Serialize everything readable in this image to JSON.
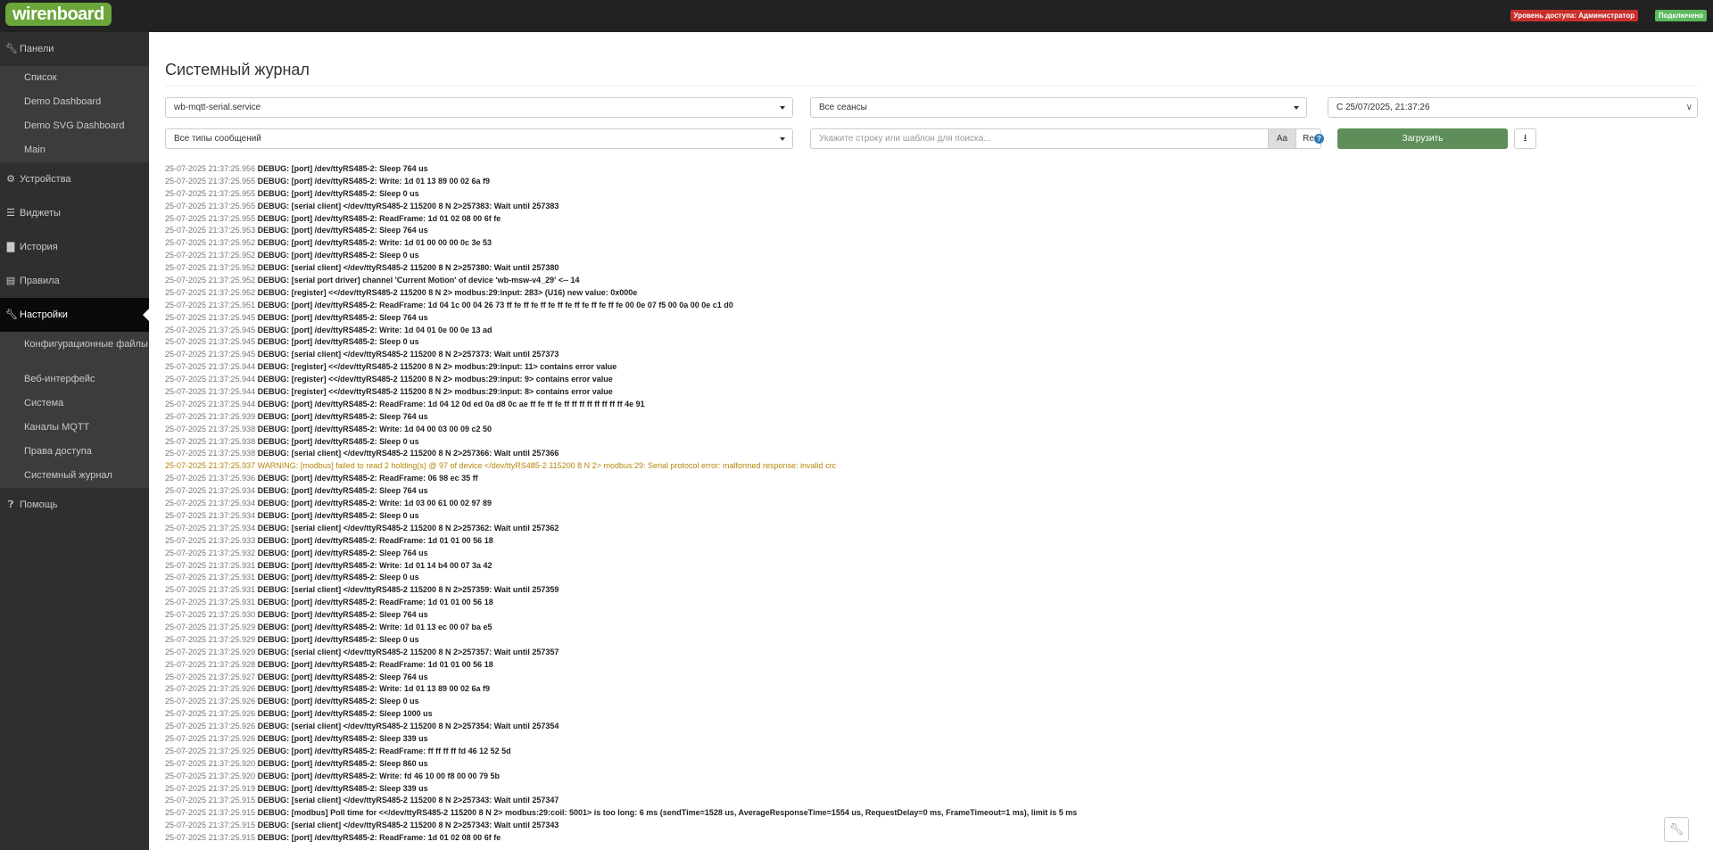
{
  "header": {
    "logo": "wirenboard",
    "access_badge": "Уровень доступа: Администратор",
    "connection_badge": "Подключено"
  },
  "sidebar": {
    "panels": {
      "label": "Панели",
      "icon": "wrench-icon",
      "items": [
        "Список",
        "Demo Dashboard",
        "Demo SVG Dashboard",
        "Main"
      ]
    },
    "devices": {
      "label": "Устройства",
      "icon": "gear-icon"
    },
    "widgets": {
      "label": "Виджеты",
      "icon": "list-icon"
    },
    "history": {
      "label": "История",
      "icon": "bar-chart-icon"
    },
    "rules": {
      "label": "Правила",
      "icon": "document-icon"
    },
    "settings": {
      "label": "Настройки",
      "icon": "wrench-icon",
      "items": [
        "Конфигурационные файлы",
        "Веб-интерфейс",
        "Система",
        "Каналы MQTT",
        "Права доступа",
        "Системный журнал"
      ]
    },
    "help": {
      "label": "Помощь",
      "icon": "question-icon"
    }
  },
  "page": {
    "title": "Системный журнал",
    "filters": {
      "service": "wb-mqtt-serial.service",
      "sessions": "Все сеансы",
      "since": "С 25/07/2025, 21:37:26",
      "message_types": "Все типы сообщений",
      "search_placeholder": "Укажите строку или шаблон для поиска...",
      "case_toggle": "Aa",
      "regex_toggle": "Re",
      "help": "?",
      "load_button": "Загрузить",
      "download_icon": "download-icon"
    }
  },
  "log": [
    {
      "ts": "25-07-2025 21:37:25.956",
      "msg": "DEBUG: [port] /dev/ttyRS485-2: Sleep 764 us"
    },
    {
      "ts": "25-07-2025 21:37:25.955",
      "msg": "DEBUG: [port] /dev/ttyRS485-2: Write: 1d 01 13 89 00 02 6a f9"
    },
    {
      "ts": "25-07-2025 21:37:25.955",
      "msg": "DEBUG: [port] /dev/ttyRS485-2: Sleep 0 us"
    },
    {
      "ts": "25-07-2025 21:37:25.955",
      "msg": "DEBUG: [serial client] </dev/ttyRS485-2 115200 8 N 2>257383: Wait until 257383"
    },
    {
      "ts": "25-07-2025 21:37:25.955",
      "msg": "DEBUG: [port] /dev/ttyRS485-2: ReadFrame: 1d 01 02 08 00 6f fe"
    },
    {
      "ts": "25-07-2025 21:37:25.953",
      "msg": "DEBUG: [port] /dev/ttyRS485-2: Sleep 764 us"
    },
    {
      "ts": "25-07-2025 21:37:25.952",
      "msg": "DEBUG: [port] /dev/ttyRS485-2: Write: 1d 01 00 00 00 0c 3e 53"
    },
    {
      "ts": "25-07-2025 21:37:25.952",
      "msg": "DEBUG: [port] /dev/ttyRS485-2: Sleep 0 us"
    },
    {
      "ts": "25-07-2025 21:37:25.952",
      "msg": "DEBUG: [serial client] </dev/ttyRS485-2 115200 8 N 2>257380: Wait until 257380"
    },
    {
      "ts": "25-07-2025 21:37:25.952",
      "msg": "DEBUG: [serial port driver] channel 'Current Motion' of device 'wb-msw-v4_29' <-- 14"
    },
    {
      "ts": "25-07-2025 21:37:25.952",
      "msg": "DEBUG: [register] <</dev/ttyRS485-2 115200 8 N 2> modbus:29:input: 283> (U16) new value: 0x000e"
    },
    {
      "ts": "25-07-2025 21:37:25.951",
      "msg": "DEBUG: [port] /dev/ttyRS485-2: ReadFrame: 1d 04 1c 00 04 26 73 ff fe ff fe ff fe ff fe ff fe ff fe ff fe 00 0e 07 f5 00 0a 00 0e c1 d0"
    },
    {
      "ts": "25-07-2025 21:37:25.945",
      "msg": "DEBUG: [port] /dev/ttyRS485-2: Sleep 764 us"
    },
    {
      "ts": "25-07-2025 21:37:25.945",
      "msg": "DEBUG: [port] /dev/ttyRS485-2: Write: 1d 04 01 0e 00 0e 13 ad"
    },
    {
      "ts": "25-07-2025 21:37:25.945",
      "msg": "DEBUG: [port] /dev/ttyRS485-2: Sleep 0 us"
    },
    {
      "ts": "25-07-2025 21:37:25.945",
      "msg": "DEBUG: [serial client] </dev/ttyRS485-2 115200 8 N 2>257373: Wait until 257373"
    },
    {
      "ts": "25-07-2025 21:37:25.944",
      "msg": "DEBUG: [register] <</dev/ttyRS485-2 115200 8 N 2> modbus:29:input: 11> contains error value"
    },
    {
      "ts": "25-07-2025 21:37:25.944",
      "msg": "DEBUG: [register] <</dev/ttyRS485-2 115200 8 N 2> modbus:29:input: 9> contains error value"
    },
    {
      "ts": "25-07-2025 21:37:25.944",
      "msg": "DEBUG: [register] <</dev/ttyRS485-2 115200 8 N 2> modbus:29:input: 8> contains error value"
    },
    {
      "ts": "25-07-2025 21:37:25.944",
      "msg": "DEBUG: [port] /dev/ttyRS485-2: ReadFrame: 1d 04 12 0d ed 0a d8 0c ae ff fe ff fe ff ff ff ff ff ff ff ff 4e 91"
    },
    {
      "ts": "25-07-2025 21:37:25.939",
      "msg": "DEBUG: [port] /dev/ttyRS485-2: Sleep 764 us"
    },
    {
      "ts": "25-07-2025 21:37:25.938",
      "msg": "DEBUG: [port] /dev/ttyRS485-2: Write: 1d 04 00 03 00 09 c2 50"
    },
    {
      "ts": "25-07-2025 21:37:25.938",
      "msg": "DEBUG: [port] /dev/ttyRS485-2: Sleep 0 us"
    },
    {
      "ts": "25-07-2025 21:37:25.938",
      "msg": "DEBUG: [serial client] </dev/ttyRS485-2 115200 8 N 2>257366: Wait until 257366"
    },
    {
      "ts": "25-07-2025 21:37:25.937",
      "msg": "WARNING: [modbus] failed to read 2 holding(s) @ 97 of device </dev/ttyRS485-2 115200 8 N 2> modbus:29: Serial protocol error: malformed response: invalid crc",
      "level": "warning"
    },
    {
      "ts": "25-07-2025 21:37:25.936",
      "msg": "DEBUG: [port] /dev/ttyRS485-2: ReadFrame: 06 98 ec 35 ff"
    },
    {
      "ts": "25-07-2025 21:37:25.934",
      "msg": "DEBUG: [port] /dev/ttyRS485-2: Sleep 764 us"
    },
    {
      "ts": "25-07-2025 21:37:25.934",
      "msg": "DEBUG: [port] /dev/ttyRS485-2: Write: 1d 03 00 61 00 02 97 89"
    },
    {
      "ts": "25-07-2025 21:37:25.934",
      "msg": "DEBUG: [port] /dev/ttyRS485-2: Sleep 0 us"
    },
    {
      "ts": "25-07-2025 21:37:25.934",
      "msg": "DEBUG: [serial client] </dev/ttyRS485-2 115200 8 N 2>257362: Wait until 257362"
    },
    {
      "ts": "25-07-2025 21:37:25.933",
      "msg": "DEBUG: [port] /dev/ttyRS485-2: ReadFrame: 1d 01 01 00 56 18"
    },
    {
      "ts": "25-07-2025 21:37:25.932",
      "msg": "DEBUG: [port] /dev/ttyRS485-2: Sleep 764 us"
    },
    {
      "ts": "25-07-2025 21:37:25.931",
      "msg": "DEBUG: [port] /dev/ttyRS485-2: Write: 1d 01 14 b4 00 07 3a 42"
    },
    {
      "ts": "25-07-2025 21:37:25.931",
      "msg": "DEBUG: [port] /dev/ttyRS485-2: Sleep 0 us"
    },
    {
      "ts": "25-07-2025 21:37:25.931",
      "msg": "DEBUG: [serial client] </dev/ttyRS485-2 115200 8 N 2>257359: Wait until 257359"
    },
    {
      "ts": "25-07-2025 21:37:25.931",
      "msg": "DEBUG: [port] /dev/ttyRS485-2: ReadFrame: 1d 01 01 00 56 18"
    },
    {
      "ts": "25-07-2025 21:37:25.930",
      "msg": "DEBUG: [port] /dev/ttyRS485-2: Sleep 764 us"
    },
    {
      "ts": "25-07-2025 21:37:25.929",
      "msg": "DEBUG: [port] /dev/ttyRS485-2: Write: 1d 01 13 ec 00 07 ba e5"
    },
    {
      "ts": "25-07-2025 21:37:25.929",
      "msg": "DEBUG: [port] /dev/ttyRS485-2: Sleep 0 us"
    },
    {
      "ts": "25-07-2025 21:37:25.929",
      "msg": "DEBUG: [serial client] </dev/ttyRS485-2 115200 8 N 2>257357: Wait until 257357"
    },
    {
      "ts": "25-07-2025 21:37:25.928",
      "msg": "DEBUG: [port] /dev/ttyRS485-2: ReadFrame: 1d 01 01 00 56 18"
    },
    {
      "ts": "25-07-2025 21:37:25.927",
      "msg": "DEBUG: [port] /dev/ttyRS485-2: Sleep 764 us"
    },
    {
      "ts": "25-07-2025 21:37:25.926",
      "msg": "DEBUG: [port] /dev/ttyRS485-2: Write: 1d 01 13 89 00 02 6a f9"
    },
    {
      "ts": "25-07-2025 21:37:25.926",
      "msg": "DEBUG: [port] /dev/ttyRS485-2: Sleep 0 us"
    },
    {
      "ts": "25-07-2025 21:37:25.926",
      "msg": "DEBUG: [port] /dev/ttyRS485-2: Sleep 1000 us"
    },
    {
      "ts": "25-07-2025 21:37:25.926",
      "msg": "DEBUG: [serial client] </dev/ttyRS485-2 115200 8 N 2>257354: Wait until 257354"
    },
    {
      "ts": "25-07-2025 21:37:25.926",
      "msg": "DEBUG: [port] /dev/ttyRS485-2: Sleep 339 us"
    },
    {
      "ts": "25-07-2025 21:37:25.925",
      "msg": "DEBUG: [port] /dev/ttyRS485-2: ReadFrame: ff ff ff ff fd 46 12 52 5d"
    },
    {
      "ts": "25-07-2025 21:37:25.920",
      "msg": "DEBUG: [port] /dev/ttyRS485-2: Sleep 860 us"
    },
    {
      "ts": "25-07-2025 21:37:25.920",
      "msg": "DEBUG: [port] /dev/ttyRS485-2: Write: fd 46 10 00 f8 00 00 79 5b"
    },
    {
      "ts": "25-07-2025 21:37:25.919",
      "msg": "DEBUG: [port] /dev/ttyRS485-2: Sleep 339 us"
    },
    {
      "ts": "25-07-2025 21:37:25.915",
      "msg": "DEBUG: [serial client] </dev/ttyRS485-2 115200 8 N 2>257343: Wait until 257347"
    },
    {
      "ts": "25-07-2025 21:37:25.915",
      "msg": "DEBUG: [modbus] Poll time for <</dev/ttyRS485-2 115200 8 N 2> modbus:29:coil: 5001> is too long: 6 ms (sendTime=1528 us, AverageResponseTime=1554 us, RequestDelay=0 ms, FrameTimeout=1 ms), limit is 5 ms"
    },
    {
      "ts": "25-07-2025 21:37:25.915",
      "msg": "DEBUG: [serial client] </dev/ttyRS485-2 115200 8 N 2>257343: Wait until 257343"
    },
    {
      "ts": "25-07-2025 21:37:25.915",
      "msg": "DEBUG: [port] /dev/ttyRS485-2: ReadFrame: 1d 01 02 08 00 6f fe"
    }
  ]
}
